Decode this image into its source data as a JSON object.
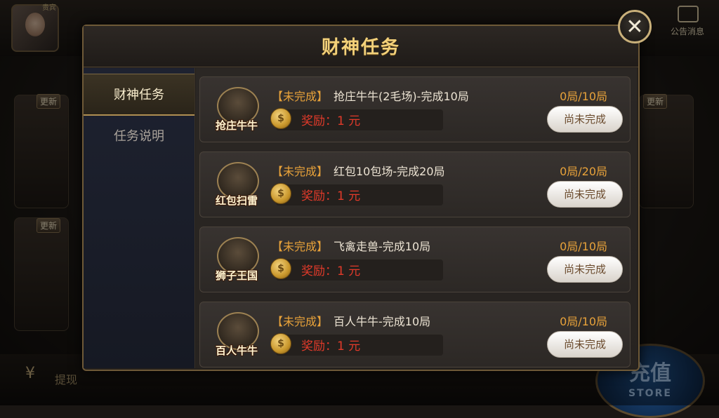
{
  "modal": {
    "title": "财神任务",
    "close_glyph": "✕"
  },
  "sidebar": {
    "tabs": [
      {
        "label": "财神任务",
        "active": true
      },
      {
        "label": "任务说明",
        "active": false
      }
    ]
  },
  "tasks": [
    {
      "game": "抢庄牛牛",
      "status": "【未完成】",
      "desc": "抢庄牛牛(2毛场)-完成10局",
      "progress": "0局/10局",
      "reward": "奖励：1 元",
      "button": "尚未完成",
      "coin": "$"
    },
    {
      "game": "红包扫雷",
      "status": "【未完成】",
      "desc": "红包10包场-完成20局",
      "progress": "0局/20局",
      "reward": "奖励：1 元",
      "button": "尚未完成",
      "coin": "$"
    },
    {
      "game": "狮子王国",
      "status": "【未完成】",
      "desc": "飞禽走兽-完成10局",
      "progress": "0局/10局",
      "reward": "奖励：1 元",
      "button": "尚未完成",
      "coin": "$"
    },
    {
      "game": "百人牛牛",
      "status": "【未完成】",
      "desc": "百人牛牛-完成10局",
      "progress": "0局/10局",
      "reward": "奖励：1 元",
      "button": "尚未完成",
      "coin": "$"
    }
  ],
  "background": {
    "notice_label": "公告消息",
    "vip_tag": "贵宾",
    "update_tag": "更新",
    "withdraw_glyph": "¥",
    "withdraw_label": "提现",
    "store_big": "充值",
    "store_small": "STORE"
  },
  "colors": {
    "accent_gold": "#f3d17a",
    "status_orange": "#e8a23a",
    "reward_red": "#e23a2a"
  }
}
